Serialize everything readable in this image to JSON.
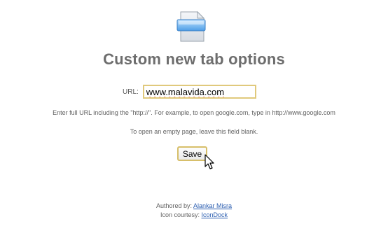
{
  "header": {
    "title": "Custom new tab options"
  },
  "form": {
    "url_label": "URL:",
    "url_value": "www.malavida.com",
    "help_text": "Enter full URL including the \"http://\". For example, to open google.com, type in http://www.google.com",
    "blank_text": "To open an empty page, leave this field blank.",
    "save_label": "Save"
  },
  "footer": {
    "authored_label": "Authored by:",
    "author_link": "Alankar Misra",
    "icon_label": "Icon courtesy:",
    "icon_link": "IconDock"
  },
  "icons": {
    "logo": "new-tab-page-icon",
    "cursor": "mouse-pointer-icon"
  },
  "colors": {
    "title": "#6d6d6d",
    "input_border": "#e0c97c",
    "link": "#2a5db0"
  }
}
